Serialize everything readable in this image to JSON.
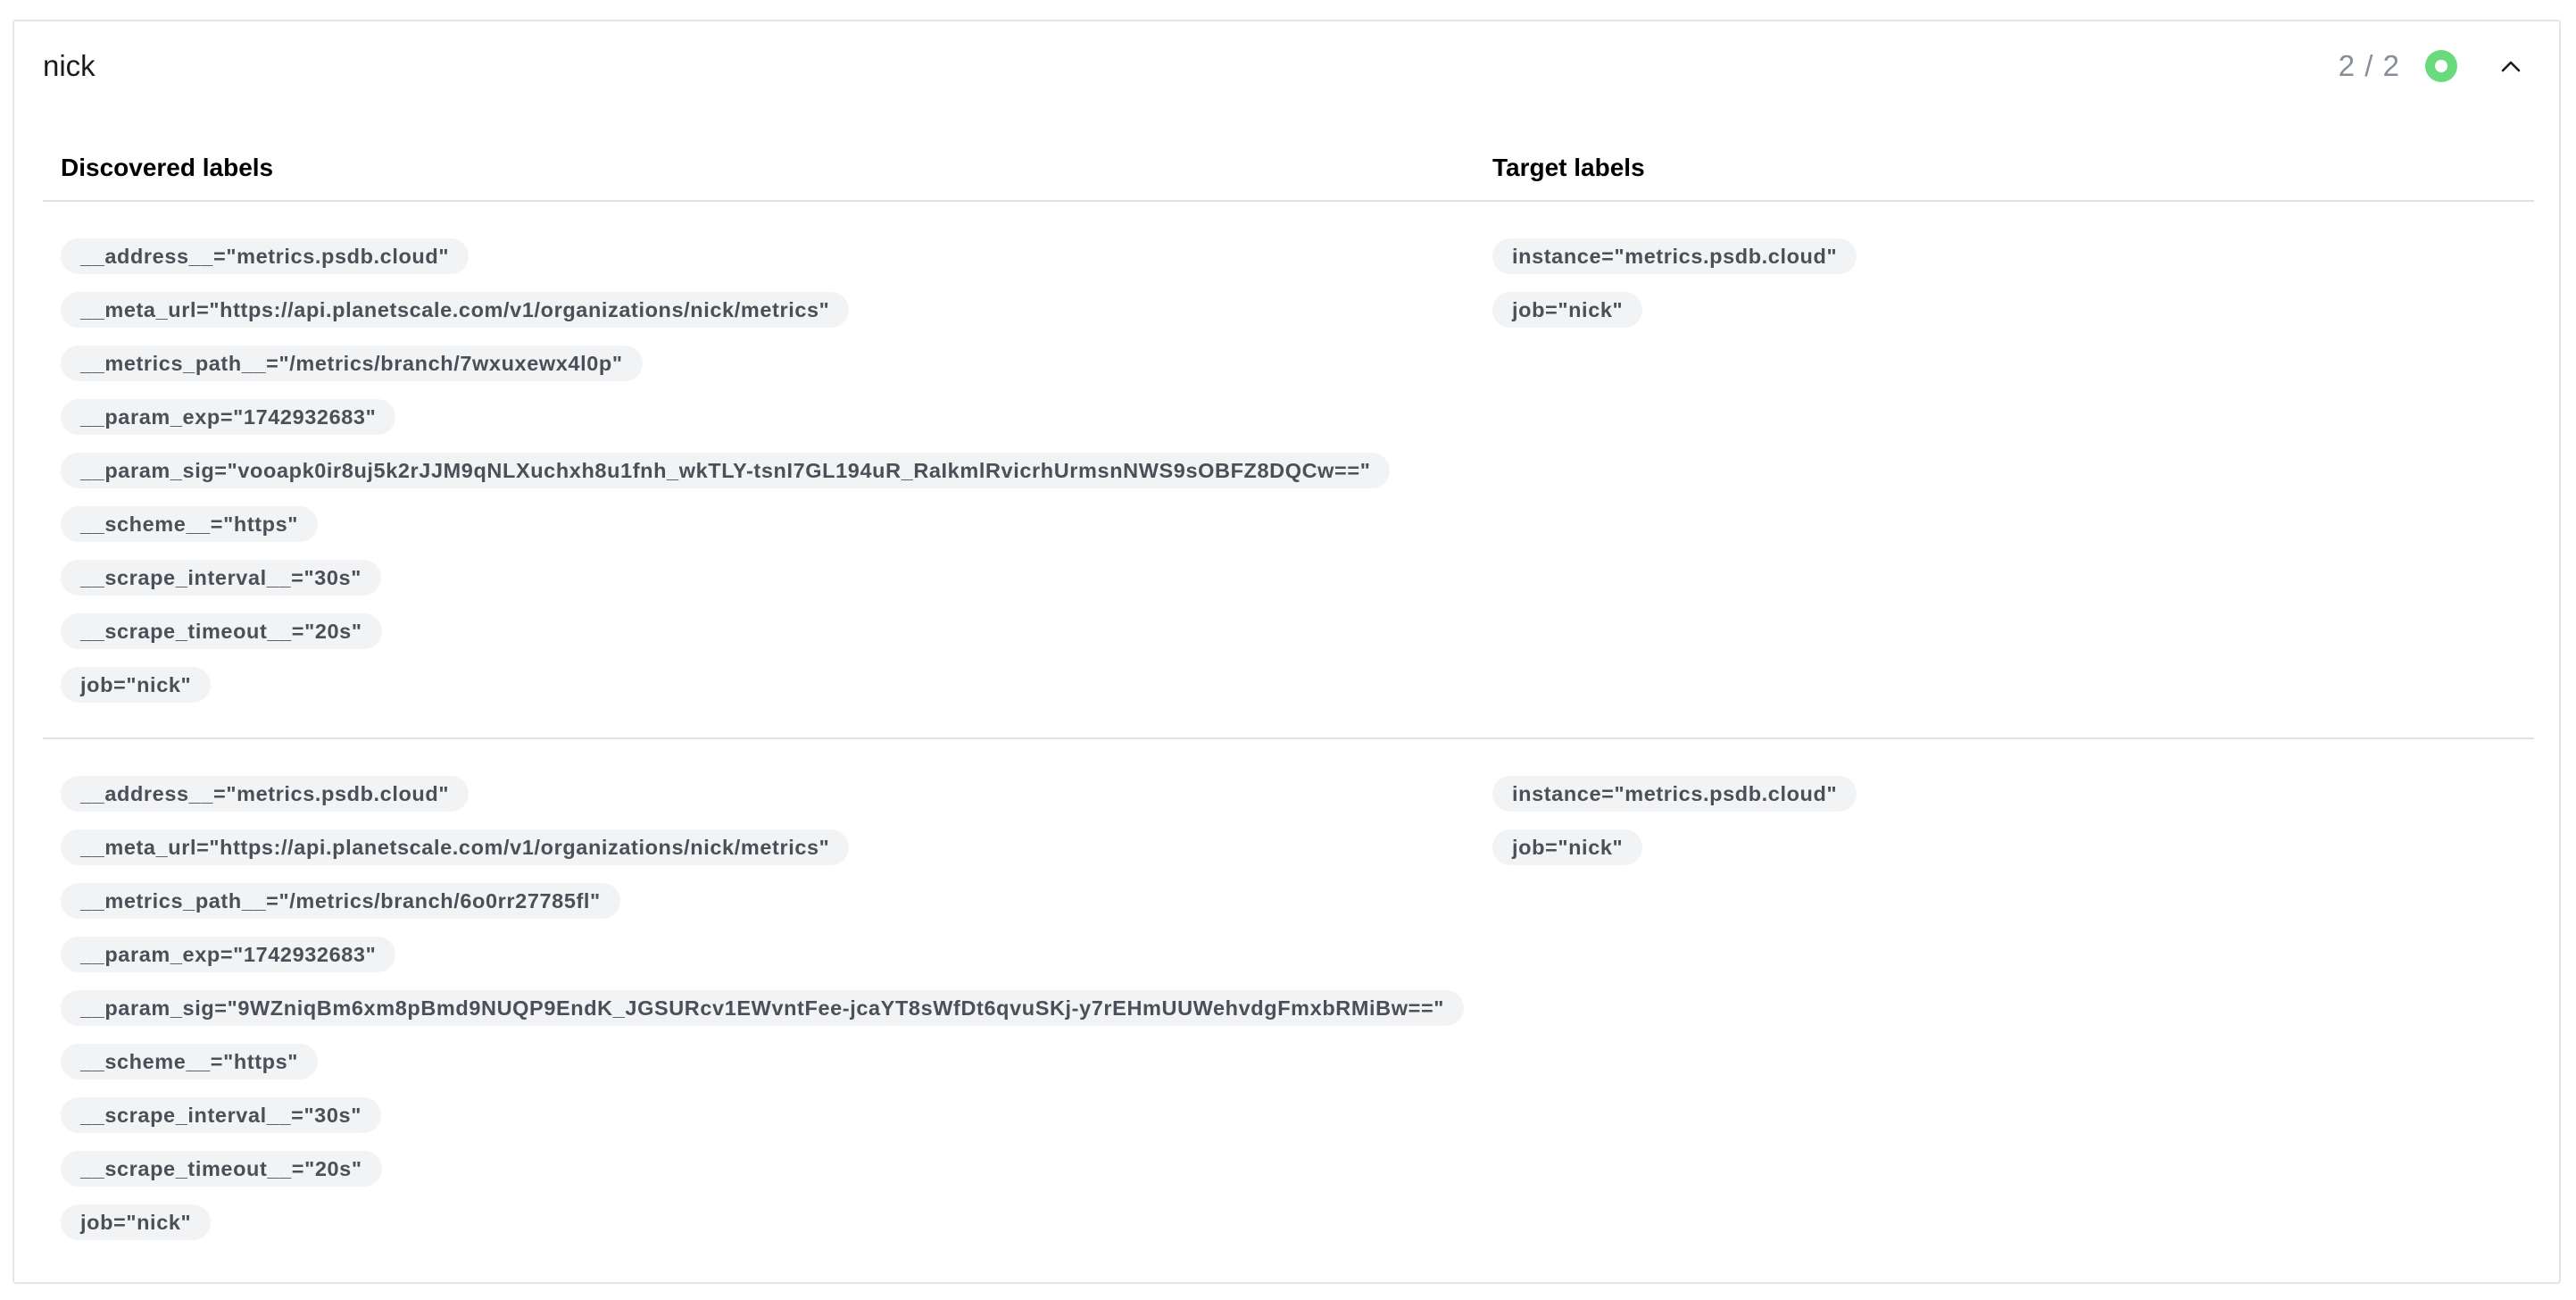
{
  "pool": {
    "name": "nick",
    "health_count": "2 / 2",
    "health_status": "up",
    "health_color": "#69db7c",
    "collapse_icon": "chevron-up-icon"
  },
  "table": {
    "headers": {
      "discovered": "Discovered labels",
      "target": "Target labels"
    },
    "rows": [
      {
        "discovered": [
          "__address__=\"metrics.psdb.cloud\"",
          "__meta_url=\"https://api.planetscale.com/v1/organizations/nick/metrics\"",
          "__metrics_path__=\"/metrics/branch/7wxuxewx4l0p\"",
          "__param_exp=\"1742932683\"",
          "__param_sig=\"vooapk0ir8uj5k2rJJM9qNLXuchxh8u1fnh_wkTLY-tsnI7GL194uR_RaIkmlRvicrhUrmsnNWS9sOBFZ8DQCw==\"",
          "__scheme__=\"https\"",
          "__scrape_interval__=\"30s\"",
          "__scrape_timeout__=\"20s\"",
          "job=\"nick\""
        ],
        "target": [
          "instance=\"metrics.psdb.cloud\"",
          "job=\"nick\""
        ]
      },
      {
        "discovered": [
          "__address__=\"metrics.psdb.cloud\"",
          "__meta_url=\"https://api.planetscale.com/v1/organizations/nick/metrics\"",
          "__metrics_path__=\"/metrics/branch/6o0rr27785fl\"",
          "__param_exp=\"1742932683\"",
          "__param_sig=\"9WZniqBm6xm8pBmd9NUQP9EndK_JGSURcv1EWvntFee-jcaYT8sWfDt6qvuSKj-y7rEHmUUWehvdgFmxbRMiBw==\"",
          "__scheme__=\"https\"",
          "__scrape_interval__=\"30s\"",
          "__scrape_timeout__=\"20s\"",
          "job=\"nick\""
        ],
        "target": [
          "instance=\"metrics.psdb.cloud\"",
          "job=\"nick\""
        ]
      }
    ]
  }
}
